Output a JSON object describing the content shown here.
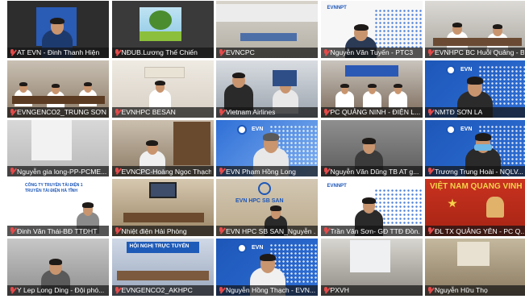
{
  "participants": [
    {
      "name": "AT EVN - Đinh Thanh Hiện"
    },
    {
      "name": "NĐUB.Lương Thế Chiến"
    },
    {
      "name": "EVNCPC"
    },
    {
      "name": "Nguyễn Văn Tuyến - PTC3"
    },
    {
      "name": "EVNHPC BC Huỗi Quảng - B..."
    },
    {
      "name": "EVNHPC BESAN"
    },
    {
      "name": "EVNHPC BESAN"
    },
    {
      "name": "Vietnam Airlines"
    },
    {
      "name": "PC QUẢNG NINH - ĐIỆN L..."
    },
    {
      "name": "NMTĐ SƠN LA"
    },
    {
      "name": "Nguyễn gia long-PP-PCME..."
    },
    {
      "name": "EVNCPC-Hoàng Ngọc Thạch"
    },
    {
      "name": "EVN Phạm Hồng Long"
    },
    {
      "name": "Nguyễn Văn Dũng TB AT g..."
    },
    {
      "name": "Trương Trung Hoài - NQLV..."
    },
    {
      "name": "Đinh Văn Thái-BĐ TTĐHT"
    },
    {
      "name": "Nhiệt điện Hải Phòng"
    },
    {
      "name": "EVN HPC SB SAN_Nguyễn ..."
    },
    {
      "name": "Trần Văn Sơn- GĐ TTĐ Đồn..."
    },
    {
      "name": "ĐL TX QUẢNG YÊN - PC Q..."
    },
    {
      "name": "Y Lep Long Ding - Đội phó..."
    },
    {
      "name": "EVNGENCO2_AKHPC"
    },
    {
      "name": "Nguyễn Hồng Thạch - EVN..."
    },
    {
      "name": "PXVH"
    },
    {
      "name": "Nguyễn Hữu Thọ"
    }
  ],
  "fix_row_2": [
    "EVNGENCO2_TRUNG SƠN",
    "EVNHPC BESAN"
  ],
  "logos": {
    "evn": "EVN",
    "evnnpt": "EVNNPT",
    "evnhpc": "EVN HPC SB SAN",
    "ptc1_line1": "CÔNG TY TRUYỀN TẢI ĐIỆN 1",
    "ptc1_line2": "TRUYỀN TẢI ĐIỆN HÀ TĨNH",
    "hoi_nghi": "HỘI NGHỊ TRỰC TUYẾN",
    "slogan": "VIỆT NAM QUANG VINH"
  },
  "colors": {
    "evn_blue": "#1d57b8",
    "mic_red": "#e24a4a",
    "active_border": "#f2c94c"
  },
  "icons": {
    "mic": "mic-muted-icon"
  }
}
